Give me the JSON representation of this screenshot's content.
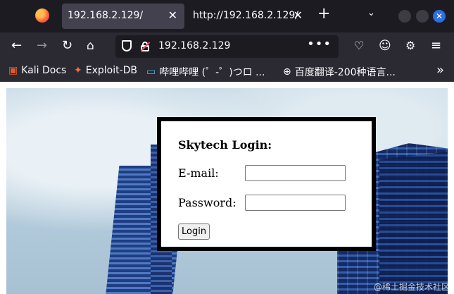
{
  "browser": {
    "tabs": [
      {
        "title": "192.168.2.129/",
        "active": true
      },
      {
        "title": "http://192.168.2.129/",
        "active": false
      }
    ],
    "new_tab": "+",
    "close_glyph": "✕",
    "url": "192.168.2.129",
    "page_actions": "•••",
    "bookmarks": [
      {
        "label": "Kali Docs",
        "icon": "kali-docs-icon"
      },
      {
        "label": "Exploit-DB",
        "icon": "exploit-db-icon"
      },
      {
        "label": "哔哩哔哩 (゜-゜)つロ ...",
        "icon": "bilibili-icon"
      },
      {
        "label": "百度翻译-200种语言...",
        "icon": "globe-icon"
      }
    ],
    "overflow": "»"
  },
  "login": {
    "title": "Skytech Login:",
    "email_label": "E-mail:",
    "email_value": "",
    "password_label": "Password:",
    "password_value": "",
    "button_label": "Login"
  },
  "watermark": "@稀土掘金技术社区",
  "colors": {
    "toolbar": "#2b2a33",
    "tabstrip": "#1c1b22",
    "active_tab": "#42414d",
    "accent_close": "#2d6fe0"
  }
}
